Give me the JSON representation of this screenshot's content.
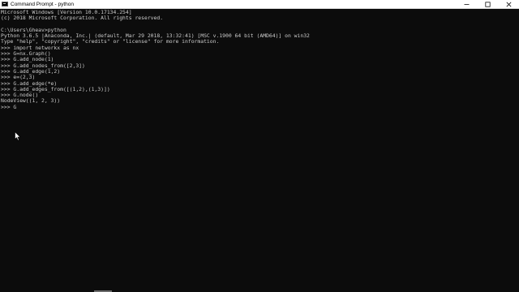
{
  "window": {
    "title": "Command Prompt - python",
    "controls": {
      "minimize_icon": "minimize-icon",
      "maximize_icon": "maximize-icon",
      "close_icon": "close-icon"
    }
  },
  "console": {
    "lines": [
      "Microsoft Windows [Version 10.0.17134.254]",
      "(c) 2018 Microsoft Corporation. All rights reserved.",
      "",
      "C:\\Users\\Gheav>python",
      "Python 3.6.5 |Anaconda, Inc.| (default, Mar 29 2018, 13:32:41) [MSC v.1900 64 bit (AMD64)] on win32",
      "Type \"help\", \"copyright\", \"credits\" or \"license\" for more information.",
      ">>> import networkx as nx",
      ">>> G=nx.Graph()",
      ">>> G.add_node(1)",
      ">>> G.add_nodes_from([2,3])",
      ">>> G.add_edge(1,2)",
      ">>> e=(2,3)",
      ">>> G.add_edge(*e)",
      ">>> G.add_edges_from([(1,2),(1,3)])",
      ">>> G.node()",
      "NodeView((1, 2, 3))",
      ">>> G"
    ]
  },
  "colors": {
    "console_background": "#0c0c0c",
    "console_text": "#cccccc",
    "titlebar_background": "#ffffff"
  }
}
